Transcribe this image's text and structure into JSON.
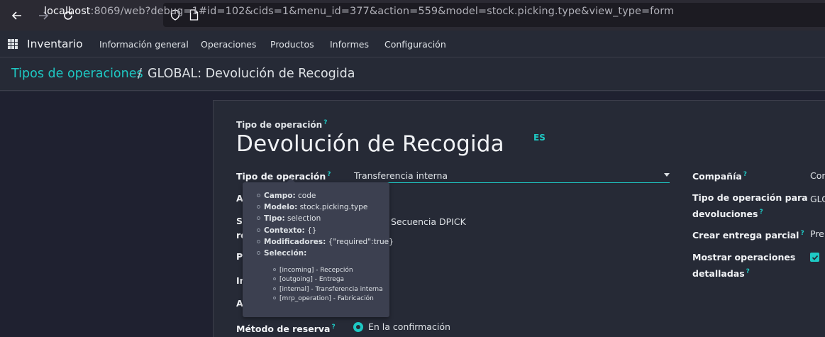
{
  "browser": {
    "url_host": "localhost",
    "url_rest": ":8069/web?debug=1#id=102&cids=1&menu_id=377&action=559&model=stock.picking.type&view_type=form"
  },
  "navbar": {
    "app_name": "Inventario",
    "menu": [
      "Información general",
      "Operaciones",
      "Productos",
      "Informes",
      "Configuración"
    ]
  },
  "breadcrumb": {
    "parent": "Tipos de operaciones",
    "separator": "/",
    "current": "GLOBAL: Devolución de Recogida"
  },
  "form": {
    "top_label": "Tipo de operación",
    "title": "Devolución de Recogida",
    "lang_badge": "ES",
    "help_mark": "?",
    "left_fields": {
      "operation_type_label": "Tipo de operación",
      "operation_type_value": "Transferencia interna",
      "partial_a": "A",
      "partial_se": "Se",
      "partial_re": "re",
      "partial_pr": "Pr",
      "partial_in": "In",
      "partial_a2": "A",
      "sequence_value": "Secuencia DPICK",
      "reserve_label": "Método de reserva",
      "reserve_value": "En la confirmación"
    },
    "right_fields": {
      "company_label": "Compañía",
      "company_value": "Cor",
      "return_type_label_1": "Tipo de operación para",
      "return_type_label_2": "devoluciones",
      "return_type_value": "GLO",
      "partial_label": "Crear entrega parcial",
      "partial_value": "Pre",
      "detailed_label_1": "Mostrar operaciones",
      "detailed_label_2": "detalladas",
      "detailed_checked": true
    }
  },
  "tooltip": {
    "rows": [
      {
        "key": "Campo:",
        "value": "code"
      },
      {
        "key": "Modelo:",
        "value": "stock.picking.type"
      },
      {
        "key": "Tipo:",
        "value": "selection"
      },
      {
        "key": "Contexto:",
        "value": "{}"
      },
      {
        "key": "Modificadores:",
        "value": "{\"required\":true}"
      },
      {
        "key": "Selección:",
        "value": ""
      }
    ],
    "options": [
      "[incoming] - Recepción",
      "[outgoing] - Entrega",
      "[internal] - Transferencia interna",
      "[mrp_operation] - Fabricación"
    ]
  },
  "colors": {
    "accent": "#1ec9c4",
    "background": "#262a36",
    "tooltip_bg": "#3c4050"
  }
}
